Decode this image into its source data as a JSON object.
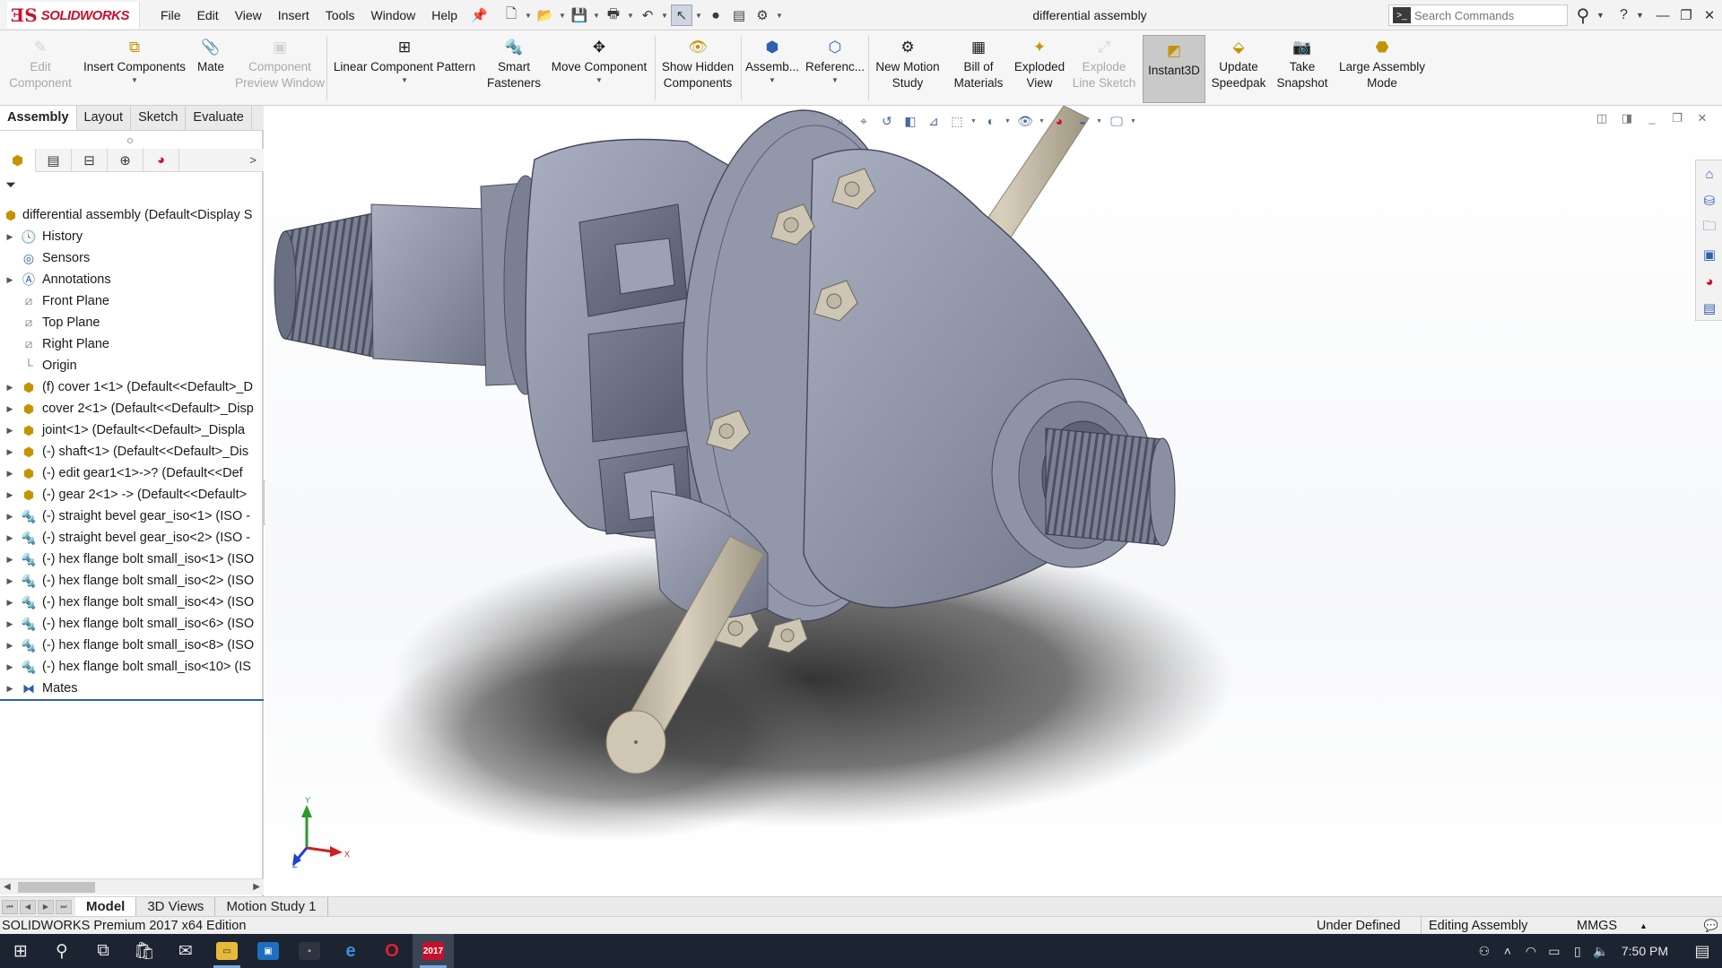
{
  "app": {
    "logo_mark": "ƎS",
    "logo_text": "SOLIDWORKS",
    "document_title": "differential assembly"
  },
  "menu": [
    "File",
    "Edit",
    "View",
    "Insert",
    "Tools",
    "Window",
    "Help"
  ],
  "search": {
    "placeholder": "Search Commands"
  },
  "ribbon": [
    {
      "label": "Edit Component",
      "icon": "edit-component-icon",
      "enabled": false,
      "dropdown": false
    },
    {
      "label": "Insert Components",
      "icon": "insert-components-icon",
      "enabled": true,
      "dropdown": true
    },
    {
      "label": "Mate",
      "icon": "mate-icon",
      "enabled": true,
      "dropdown": false
    },
    {
      "label": "Component Preview Window",
      "icon": "preview-window-icon",
      "enabled": false,
      "dropdown": false
    },
    {
      "label": "Linear Component Pattern",
      "icon": "linear-pattern-icon",
      "enabled": true,
      "dropdown": true
    },
    {
      "label": "Smart Fasteners",
      "icon": "smart-fasteners-icon",
      "enabled": true,
      "dropdown": false
    },
    {
      "label": "Move Component",
      "icon": "move-component-icon",
      "enabled": true,
      "dropdown": true
    },
    {
      "label": "Show Hidden Components",
      "icon": "show-hidden-icon",
      "enabled": true,
      "dropdown": false
    },
    {
      "label": "Assemb...",
      "icon": "assembly-features-icon",
      "enabled": true,
      "dropdown": true
    },
    {
      "label": "Referenc...",
      "icon": "reference-geometry-icon",
      "enabled": true,
      "dropdown": true
    },
    {
      "label": "New Motion Study",
      "icon": "motion-study-icon",
      "enabled": true,
      "dropdown": false
    },
    {
      "label": "Bill of Materials",
      "icon": "bom-icon",
      "enabled": true,
      "dropdown": false
    },
    {
      "label": "Exploded View",
      "icon": "exploded-view-icon",
      "enabled": true,
      "dropdown": false
    },
    {
      "label": "Explode Line Sketch",
      "icon": "explode-line-icon",
      "enabled": false,
      "dropdown": false
    },
    {
      "label": "Instant3D",
      "icon": "instant3d-icon",
      "enabled": true,
      "dropdown": false,
      "pressed": true
    },
    {
      "label": "Update Speedpak",
      "icon": "speedpak-icon",
      "enabled": true,
      "dropdown": false
    },
    {
      "label": "Take Snapshot",
      "icon": "camera-icon",
      "enabled": true,
      "dropdown": false
    },
    {
      "label": "Large Assembly Mode",
      "icon": "large-assembly-icon",
      "enabled": true,
      "dropdown": false
    }
  ],
  "cm_tabs": [
    {
      "label": "Assembly",
      "active": true
    },
    {
      "label": "Layout",
      "active": false
    },
    {
      "label": "Sketch",
      "active": false
    },
    {
      "label": "Evaluate",
      "active": false
    }
  ],
  "tree": {
    "root": "differential assembly  (Default<Display S",
    "items": [
      {
        "label": "History",
        "icon": "history-icon",
        "expandable": true
      },
      {
        "label": "Sensors",
        "icon": "sensors-icon",
        "expandable": false
      },
      {
        "label": "Annotations",
        "icon": "annotations-icon",
        "expandable": true
      },
      {
        "label": "Front Plane",
        "icon": "plane-icon",
        "expandable": false
      },
      {
        "label": "Top Plane",
        "icon": "plane-icon",
        "expandable": false
      },
      {
        "label": "Right Plane",
        "icon": "plane-icon",
        "expandable": false
      },
      {
        "label": "Origin",
        "icon": "origin-icon",
        "expandable": false
      },
      {
        "label": "(f) cover 1<1> (Default<<Default>_D",
        "icon": "part-icon",
        "expandable": true
      },
      {
        "label": "cover 2<1> (Default<<Default>_Disp",
        "icon": "part-icon",
        "expandable": true
      },
      {
        "label": "joint<1> (Default<<Default>_Displa",
        "icon": "part-icon",
        "expandable": true
      },
      {
        "label": "(-) shaft<1> (Default<<Default>_Dis",
        "icon": "part-icon",
        "expandable": true
      },
      {
        "label": "(-) edit gear1<1>->? (Default<<Def",
        "icon": "part-icon",
        "expandable": true
      },
      {
        "label": "(-) gear 2<1> -> (Default<<Default>",
        "icon": "part-icon",
        "expandable": true
      },
      {
        "label": "(-) straight bevel gear_iso<1> (ISO - ",
        "icon": "toolbox-part-icon",
        "expandable": true
      },
      {
        "label": "(-) straight bevel gear_iso<2> (ISO - ",
        "icon": "toolbox-part-icon",
        "expandable": true
      },
      {
        "label": "(-) hex flange bolt small_iso<1> (ISO",
        "icon": "toolbox-part-icon",
        "expandable": true
      },
      {
        "label": "(-) hex flange bolt small_iso<2> (ISO",
        "icon": "toolbox-part-icon",
        "expandable": true
      },
      {
        "label": "(-) hex flange bolt small_iso<4> (ISO",
        "icon": "toolbox-part-icon",
        "expandable": true
      },
      {
        "label": "(-) hex flange bolt small_iso<6> (ISO",
        "icon": "toolbox-part-icon",
        "expandable": true
      },
      {
        "label": "(-) hex flange bolt small_iso<8> (ISO",
        "icon": "toolbox-part-icon",
        "expandable": true
      },
      {
        "label": "(-) hex flange bolt small_iso<10> (IS",
        "icon": "toolbox-part-icon",
        "expandable": true
      },
      {
        "label": "Mates",
        "icon": "mates-icon",
        "expandable": true
      }
    ]
  },
  "triad": {
    "x": "X",
    "y": "Y",
    "z": "Z"
  },
  "bottom_tabs": [
    {
      "label": "Model",
      "active": true
    },
    {
      "label": "3D Views",
      "active": false
    },
    {
      "label": "Motion Study 1",
      "active": false
    }
  ],
  "status": {
    "product": "SOLIDWORKS Premium 2017 x64 Edition",
    "definition": "Under Defined",
    "mode": "Editing Assembly",
    "units": "MMGS"
  },
  "taskbar": {
    "clock": "7:50 PM",
    "solidworks_badge": "2017"
  },
  "colors": {
    "brand": "#c8102e",
    "model_body": "#8f94a6",
    "shaft": "#c9c0ad",
    "taskbar": "#1b2430"
  }
}
